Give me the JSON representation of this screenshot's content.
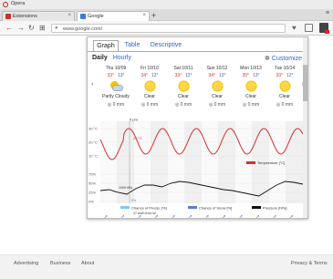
{
  "window": {
    "title": "Opera"
  },
  "tabs": [
    {
      "label": "Extensions"
    },
    {
      "label": "Google"
    }
  ],
  "toolbar": {
    "url": "www.google.com/"
  },
  "widget": {
    "tabs": [
      "Graph",
      "Table",
      "Descriptive"
    ],
    "active_tab": "Graph",
    "daily_label": "Daily",
    "hourly_label": "Hourly",
    "customize_label": "Customize",
    "days": [
      {
        "name": "Thu 10/09",
        "hi": "33°",
        "lo": "13°",
        "cond": "Partly Cloudy",
        "precip": "0 mm",
        "icon": "partly-cloudy"
      },
      {
        "name": "Fri 10/10",
        "hi": "34°",
        "lo": "12°",
        "cond": "Clear",
        "precip": "0 mm",
        "icon": "sun"
      },
      {
        "name": "Sat 10/11",
        "hi": "33°",
        "lo": "12°",
        "cond": "Clear",
        "precip": "0 mm",
        "icon": "sun"
      },
      {
        "name": "Sun 10/12",
        "hi": "34°",
        "lo": "13°",
        "cond": "Clear",
        "precip": "0 mm",
        "icon": "sun"
      },
      {
        "name": "Mon 10/13",
        "hi": "30°",
        "lo": "13°",
        "cond": "Clear",
        "precip": "0 mm",
        "icon": "sun"
      },
      {
        "name": "Tue 10/14",
        "hi": "33°",
        "lo": "12°",
        "cond": "Clear",
        "precip": "0 mm",
        "icon": "sun"
      }
    ],
    "tooltip_time": "9 pm",
    "tooltip_temp": "22 °C",
    "tooltip_pressure": "1009 hPa",
    "tooltip_wind": "27 km/h from W",
    "tooltip_precip": "0%",
    "left_axis": [
      "30 °C",
      "20 °C",
      "10 °C",
      "75%",
      "50%",
      "25%",
      "0%"
    ],
    "right_axis": [
      "1016",
      "1013",
      "1010",
      "1007"
    ],
    "legend": {
      "temperature": "Temperature [°C]",
      "precip": "Chance of Precip. [%]",
      "snow": "Chance of Snow [%]",
      "pressure": "Pressure [hPa]"
    }
  },
  "footer": {
    "advertising": "Advertising",
    "business": "Business",
    "about": "About",
    "privacy": "Privacy & Terms"
  },
  "colors": {
    "temperature": "#d43030",
    "pressure": "#111111",
    "precip": "#7ec8ea",
    "snow": "#5a7bd6",
    "link": "#3366cc"
  }
}
